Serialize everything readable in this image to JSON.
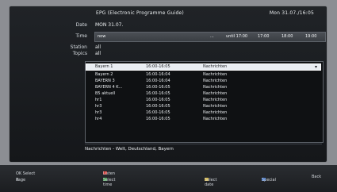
{
  "header": {
    "title": "EPG (Electronic Programme Guide)",
    "datetime": "Mon 31.07./16:05"
  },
  "fields": {
    "date_label": "Date",
    "date_value": "MON 31.07.",
    "time_label": "Time",
    "time_value": "now",
    "station_label": "Station",
    "station_value": "all",
    "topics_label": "Topics",
    "topics_value": "all"
  },
  "timebar": {
    "items": [
      "...",
      "until 17:00",
      "17:00",
      "18:00",
      "19:00"
    ]
  },
  "list": {
    "selected": {
      "channel": "Bayern 1",
      "time": "16:00-16:05",
      "title": "Nachrichten"
    },
    "rows": [
      {
        "channel": "Bayern 2",
        "time": "16:00-16:04",
        "title": "Nachrichten"
      },
      {
        "channel": "BAYERN 3",
        "time": "16:00-16:04",
        "title": "Nachrichten"
      },
      {
        "channel": "BAYERN 4 K...",
        "time": "16:00-16:05",
        "title": "Nachrichten"
      },
      {
        "channel": "B5 aktuell",
        "time": "16:00-16:05",
        "title": "Nachrichten"
      },
      {
        "channel": "hr1",
        "time": "16:00-16:05",
        "title": "Nachrichten"
      },
      {
        "channel": "hr3",
        "time": "16:00-16:05",
        "title": "Nachrichten"
      },
      {
        "channel": "hr3",
        "time": "16:00-16:05",
        "title": "Nachrichten"
      },
      {
        "channel": "hr4",
        "time": "16:00-16:05",
        "title": "Nachrichten"
      }
    ]
  },
  "info": {
    "text": "Nachrichten - Welt, Deutschland, Bayern"
  },
  "footer": {
    "select_label": "OK Select",
    "page_label": "Page",
    "listen_label": "Listen",
    "select_time_label": "Select time",
    "select_date_label": "Select date",
    "special_label": "Special",
    "back_label": "Back"
  }
}
